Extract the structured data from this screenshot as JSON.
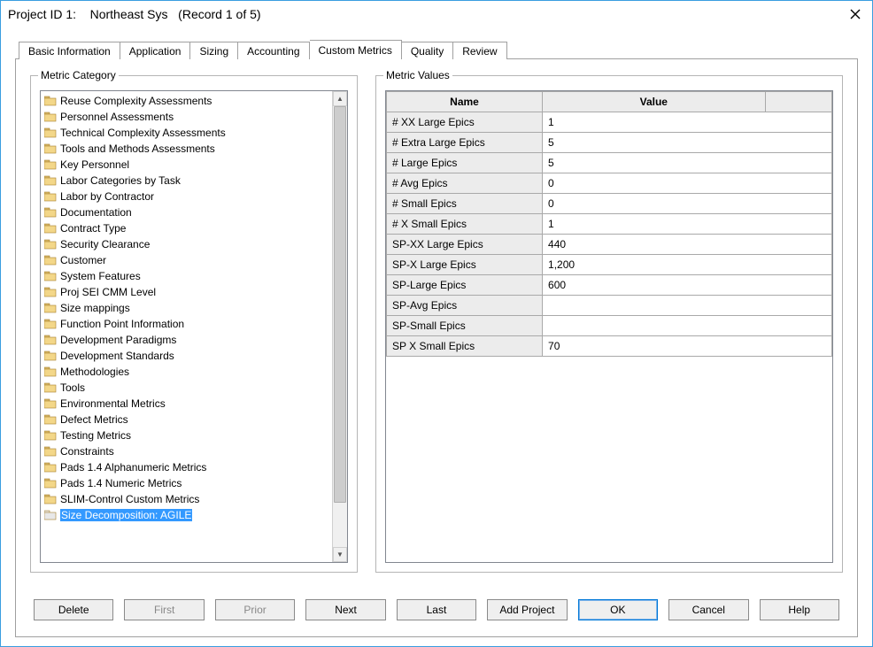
{
  "window": {
    "title": "Project ID 1:    Northeast Sys   (Record 1 of 5)"
  },
  "tabs": [
    {
      "label": "Basic Information",
      "active": false
    },
    {
      "label": "Application",
      "active": false
    },
    {
      "label": "Sizing",
      "active": false
    },
    {
      "label": "Accounting",
      "active": false
    },
    {
      "label": "Custom Metrics",
      "active": true
    },
    {
      "label": "Quality",
      "active": false
    },
    {
      "label": "Review",
      "active": false
    }
  ],
  "metric_category": {
    "legend": "Metric Category",
    "items": [
      {
        "label": "Reuse Complexity Assessments",
        "selected": false
      },
      {
        "label": "Personnel Assessments",
        "selected": false
      },
      {
        "label": "Technical Complexity Assessments",
        "selected": false
      },
      {
        "label": "Tools and Methods Assessments",
        "selected": false
      },
      {
        "label": "Key Personnel",
        "selected": false
      },
      {
        "label": "Labor Categories by Task",
        "selected": false
      },
      {
        "label": "Labor by Contractor",
        "selected": false
      },
      {
        "label": "Documentation",
        "selected": false
      },
      {
        "label": "Contract Type",
        "selected": false
      },
      {
        "label": "Security Clearance",
        "selected": false
      },
      {
        "label": "Customer",
        "selected": false
      },
      {
        "label": "System Features",
        "selected": false
      },
      {
        "label": "Proj SEI CMM Level",
        "selected": false
      },
      {
        "label": "Size mappings",
        "selected": false
      },
      {
        "label": "Function Point Information",
        "selected": false
      },
      {
        "label": "Development Paradigms",
        "selected": false
      },
      {
        "label": "Development Standards",
        "selected": false
      },
      {
        "label": "Methodologies",
        "selected": false
      },
      {
        "label": "Tools",
        "selected": false
      },
      {
        "label": "Environmental Metrics",
        "selected": false
      },
      {
        "label": "Defect Metrics",
        "selected": false
      },
      {
        "label": "Testing Metrics",
        "selected": false
      },
      {
        "label": "Constraints",
        "selected": false
      },
      {
        "label": "Pads 1.4 Alphanumeric Metrics",
        "selected": false
      },
      {
        "label": "Pads 1.4 Numeric Metrics",
        "selected": false
      },
      {
        "label": "SLIM-Control Custom Metrics",
        "selected": false
      },
      {
        "label": "Size Decomposition: AGILE",
        "selected": true
      }
    ]
  },
  "metric_values": {
    "legend": "Metric Values",
    "headers": {
      "name": "Name",
      "value": "Value"
    },
    "rows": [
      {
        "name": "# XX Large Epics",
        "value": "1"
      },
      {
        "name": "# Extra Large Epics",
        "value": "5"
      },
      {
        "name": "# Large Epics",
        "value": "5"
      },
      {
        "name": "# Avg Epics",
        "value": "0"
      },
      {
        "name": "# Small Epics",
        "value": "0"
      },
      {
        "name": "# X Small Epics",
        "value": "1"
      },
      {
        "name": "SP-XX Large Epics",
        "value": "440"
      },
      {
        "name": "SP-X Large Epics",
        "value": "1,200"
      },
      {
        "name": "SP-Large Epics",
        "value": "600"
      },
      {
        "name": "SP-Avg Epics",
        "value": ""
      },
      {
        "name": "SP-Small Epics",
        "value": ""
      },
      {
        "name": "SP X Small Epics",
        "value": "70"
      }
    ]
  },
  "footer": {
    "delete": "Delete",
    "first": "First",
    "prior": "Prior",
    "next": "Next",
    "last": "Last",
    "add": "Add Project",
    "ok": "OK",
    "cancel": "Cancel",
    "help": "Help"
  }
}
